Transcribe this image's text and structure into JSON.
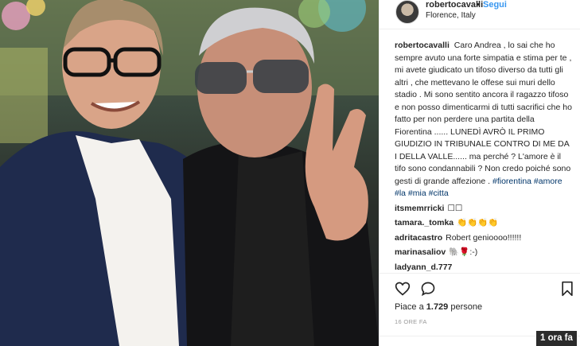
{
  "post": {
    "username": "robertocavalli",
    "separator": "•",
    "follow_label": "Segui",
    "location": "Florence, Italy"
  },
  "caption": {
    "username": "robertocavalli",
    "text": "Caro Andrea , lo sai che ho sempre avuto una forte simpatia e stima per te , mi avete giudicato un tifoso diverso da tutti gli altri , che mettevano le offese sui muri dello stadio . Mi sono sentito ancora il ragazzo tifoso e non posso dimenticarmi di tutti sacrifici che ho fatto per non perdere una partita della Fiorentina ...... LUNEDÌ AVRÒ IL PRIMO GIUDIZIO IN TRIBUNALE CONTRO DI ME DA I DELLA VALLE...... ma perché ? L'amore è il tifo sono condannabili ? Non credo poiché sono gesti di grande affezione .",
    "hashtags": "#fiorentina #amore #la #mia #citta"
  },
  "comments": [
    {
      "user": "itsmemrricki",
      "text": "☐☐"
    },
    {
      "user": "tamara._tomka",
      "text": "👏👏👏👏"
    },
    {
      "user": "adritacastro",
      "text": "Robert genioooo!!!!!!"
    },
    {
      "user": "marinasaliov",
      "text": "🐘🌹:-)"
    },
    {
      "user": "ladyann_d.777",
      "text": ""
    }
  ],
  "likes": {
    "prefix": "Piace a",
    "count": "1.729",
    "suffix": "persone"
  },
  "time_ago": "16 ORE FA",
  "badge": "1 ora fa",
  "icons": {
    "heart": "heart-icon",
    "comment": "comment-icon",
    "save": "bookmark-icon"
  },
  "colors": {
    "link": "#3897f0",
    "hashtag": "#003569",
    "text": "#262626",
    "muted": "#999999",
    "badge_bg": "#2b2b2b"
  }
}
